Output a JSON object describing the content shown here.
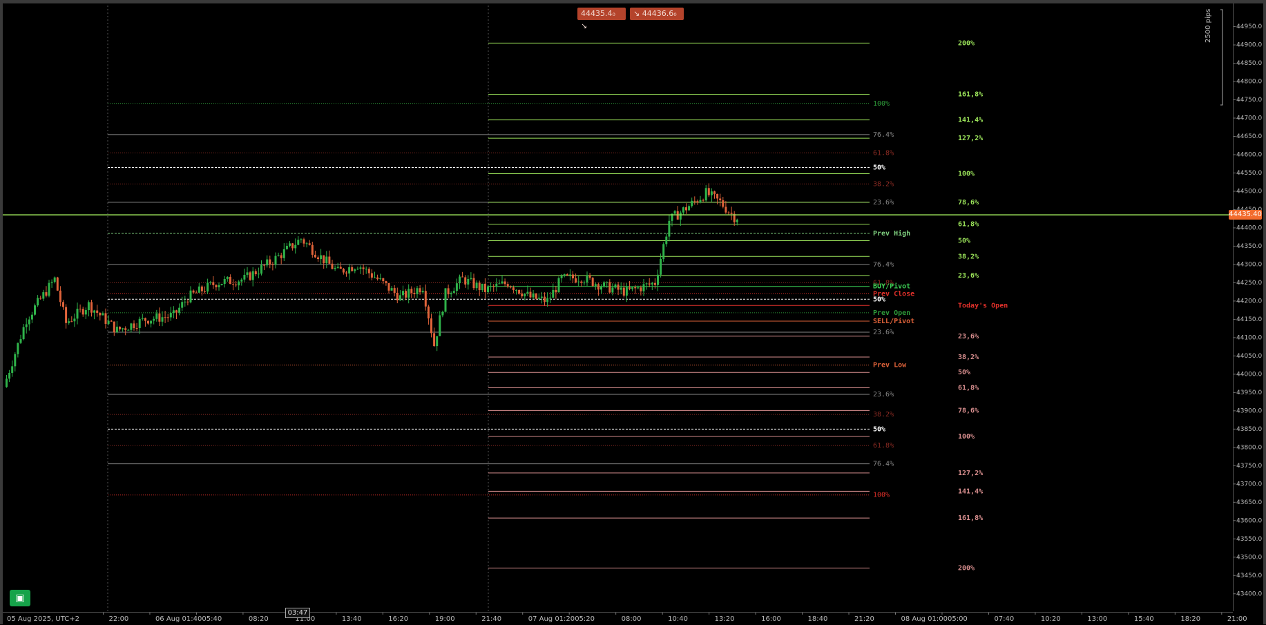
{
  "quotes": {
    "bid": "44435.4₀",
    "ask": "44436.6₀",
    "bid_icon": "down-right-arrow-icon",
    "ask_icon": "down-right-arrow-icon"
  },
  "current_price": "44435.40",
  "measure_label": "2500 pips",
  "time_cursor": "03:47",
  "bot_icon": "robot-icon",
  "colors": {
    "bull": "#2fb34a",
    "bear": "#e0633a",
    "accent": "#9be35a",
    "red_text": "#e0302a",
    "pink": "#d98f8f",
    "grey": "#888888",
    "white": "#ffffff"
  },
  "price_axis": {
    "ticks": [
      "44950.0",
      "44900.0",
      "44850.0",
      "44800.0",
      "44750.0",
      "44700.0",
      "44650.0",
      "44600.0",
      "44550.0",
      "44500.0",
      "44450.0",
      "44400.0",
      "44350.0",
      "44300.0",
      "44250.0",
      "44200.0",
      "44150.0",
      "44100.0",
      "44050.0",
      "44000.0",
      "43950.0",
      "43900.0",
      "43850.0",
      "43800.0",
      "43750.0",
      "43700.0",
      "43650.0",
      "43600.0",
      "43550.0",
      "43500.0",
      "43450.0",
      "43400.0"
    ]
  },
  "time_axis": {
    "labels": [
      "05 Aug 2025, UTC+2",
      "22:00",
      "06 Aug 01:40",
      "05:40",
      "08:20",
      "11:00",
      "13:40",
      "16:20",
      "19:00",
      "21:40",
      "07 Aug 01:20",
      "05:20",
      "08:00",
      "10:40",
      "13:20",
      "16:00",
      "18:40",
      "21:20",
      "08 Aug 01:00",
      "05:00",
      "07:40",
      "10:20",
      "13:00",
      "15:40",
      "18:20",
      "21:00"
    ]
  },
  "chart_data": {
    "type": "candlestick",
    "current_price": 44435.4,
    "price_range": [
      43375,
      44985
    ],
    "levels": [
      {
        "text": "100%",
        "price": 44740,
        "color": "#2e9c3a",
        "style": "dotted",
        "span": "day1"
      },
      {
        "text": "76.4%",
        "price": 44655,
        "color": "#888888",
        "style": "solid",
        "span": "day1"
      },
      {
        "text": "61.8%",
        "price": 44605,
        "color": "#8b2b23",
        "style": "dotted",
        "span": "day1"
      },
      {
        "text": "50%",
        "price": 44565,
        "color": "#ffffff",
        "style": "dashed",
        "span": "day1"
      },
      {
        "text": "38.2%",
        "price": 44520,
        "color": "#8b2b23",
        "style": "dotted",
        "span": "day1"
      },
      {
        "text": "23.6%",
        "price": 44470,
        "color": "#888888",
        "style": "solid",
        "span": "day1"
      },
      {
        "text": "Prev High",
        "price": 44385,
        "color": "#7fd07f",
        "style": "dashed",
        "span": "day1"
      },
      {
        "text": "76.4%",
        "price": 44300,
        "color": "#888888",
        "style": "solid",
        "span": "day1"
      },
      {
        "text": "61.8%",
        "price": 44250,
        "color": "#8b2b23",
        "style": "dotted",
        "span": "day1"
      },
      {
        "text": "BUY/Pivot",
        "price": 44240,
        "color": "#3ccf55",
        "style": "solid",
        "span": "day2"
      },
      {
        "text": "Prev Close",
        "price": 44220,
        "color": "#e0302a",
        "style": "dotted",
        "span": "day1"
      },
      {
        "text": "50%",
        "price": 44205,
        "color": "#ffffff",
        "style": "dashed",
        "span": "day1"
      },
      {
        "text": "Prev Open",
        "price": 44168,
        "color": "#2e9c3a",
        "style": "dotted",
        "span": "day1"
      },
      {
        "text": "SELL/Pivot",
        "price": 44145,
        "color": "#e0633a",
        "style": "solid",
        "span": "day2"
      },
      {
        "text": "23.6%",
        "price": 44115,
        "color": "#888888",
        "style": "solid",
        "span": "day1"
      },
      {
        "text": "Prev Low",
        "price": 44025,
        "color": "#e0633a",
        "style": "dotted",
        "span": "day1"
      },
      {
        "text": "23.6%",
        "price": 43945,
        "color": "#888888",
        "style": "solid",
        "span": "day1"
      },
      {
        "text": "38.2%",
        "price": 43890,
        "color": "#8b2b23",
        "style": "dotted",
        "span": "day1"
      },
      {
        "text": "50%",
        "price": 43850,
        "color": "#ffffff",
        "style": "dashed",
        "span": "day1"
      },
      {
        "text": "61.8%",
        "price": 43805,
        "color": "#8b2b23",
        "style": "dotted",
        "span": "day1"
      },
      {
        "text": "76.4%",
        "price": 43755,
        "color": "#888888",
        "style": "solid",
        "span": "day1"
      },
      {
        "text": "100%",
        "price": 43670,
        "color": "#e0302a",
        "style": "dotted",
        "span": "day1"
      }
    ],
    "fib_up": [
      {
        "text": "200%",
        "price": 44905
      },
      {
        "text": "161,8%",
        "price": 44765
      },
      {
        "text": "141,4%",
        "price": 44695
      },
      {
        "text": "127,2%",
        "price": 44645
      },
      {
        "text": "100%",
        "price": 44548
      },
      {
        "text": "78,6%",
        "price": 44470
      },
      {
        "text": "61,8%",
        "price": 44410
      },
      {
        "text": "50%",
        "price": 44365
      },
      {
        "text": "38,2%",
        "price": 44322
      },
      {
        "text": "23,6%",
        "price": 44270
      }
    ],
    "todays_open": {
      "text": "Today's Open",
      "price": 44188
    },
    "fib_down": [
      {
        "text": "23,6%",
        "price": 44104
      },
      {
        "text": "38,2%",
        "price": 44047
      },
      {
        "text": "50%",
        "price": 44005
      },
      {
        "text": "61,8%",
        "price": 43963
      },
      {
        "text": "78,6%",
        "price": 43901
      },
      {
        "text": "100%",
        "price": 43830
      },
      {
        "text": "127,2%",
        "price": 43730
      },
      {
        "text": "141,4%",
        "price": 43680
      },
      {
        "text": "161,8%",
        "price": 43607
      },
      {
        "text": "200%",
        "price": 43470
      }
    ],
    "candles": {
      "count": 226,
      "anchors": [
        [
          0,
          43965
        ],
        [
          8,
          44150
        ],
        [
          18,
          44260
        ],
        [
          22,
          44140
        ],
        [
          30,
          44190
        ],
        [
          40,
          44120
        ],
        [
          50,
          44150
        ],
        [
          60,
          44160
        ],
        [
          65,
          44210
        ],
        [
          75,
          44250
        ],
        [
          85,
          44260
        ],
        [
          95,
          44310
        ],
        [
          105,
          44370
        ],
        [
          112,
          44320
        ],
        [
          118,
          44280
        ],
        [
          125,
          44300
        ],
        [
          132,
          44260
        ],
        [
          140,
          44210
        ],
        [
          148,
          44240
        ],
        [
          152,
          44080
        ],
        [
          156,
          44220
        ],
        [
          162,
          44260
        ],
        [
          170,
          44230
        ],
        [
          178,
          44250
        ],
        [
          186,
          44210
        ],
        [
          192,
          44200
        ],
        [
          197,
          44260
        ],
        [
          204,
          44265
        ],
        [
          212,
          44240
        ],
        [
          220,
          44225
        ],
        [
          230,
          44250
        ],
        [
          235,
          44420
        ],
        [
          242,
          44460
        ],
        [
          248,
          44495
        ],
        [
          253,
          44470
        ],
        [
          258,
          44430
        ]
      ]
    }
  }
}
